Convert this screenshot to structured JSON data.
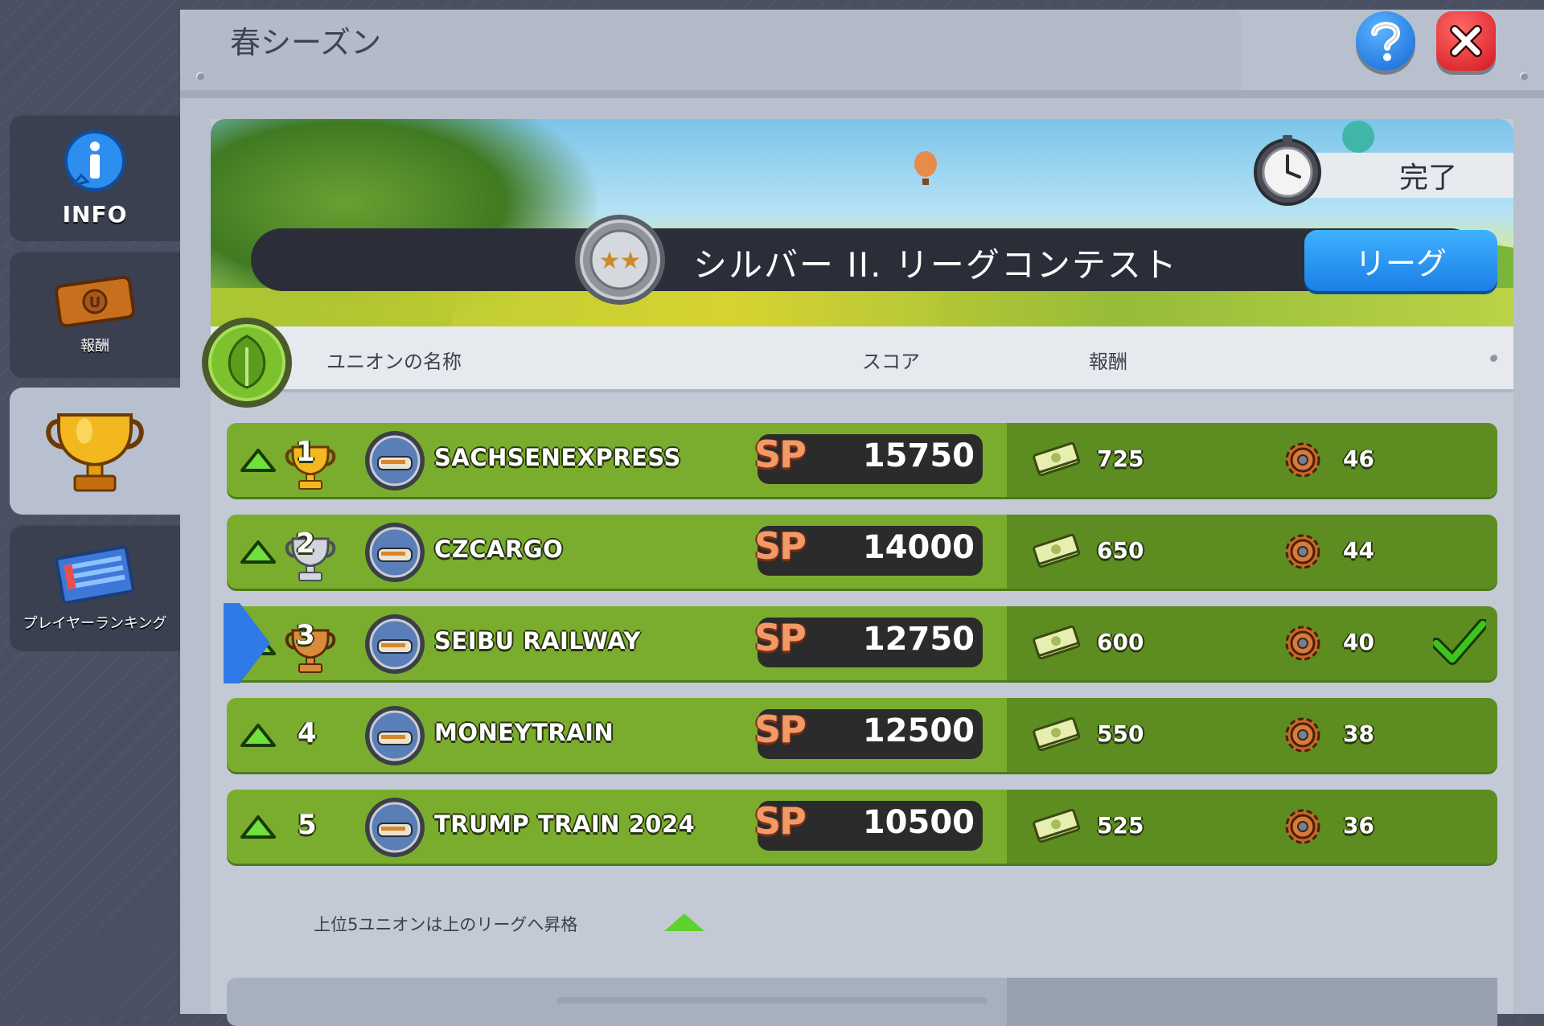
{
  "window": {
    "title": "春シーズン"
  },
  "sidebar": {
    "items": [
      {
        "label": "INFO",
        "icon": "info-icon"
      },
      {
        "label": "報酬",
        "icon": "ticket-icon"
      },
      {
        "label": "",
        "icon": "trophy-icon",
        "active": true
      },
      {
        "label": "プレイヤーランキング",
        "icon": "ranking-board-icon"
      }
    ]
  },
  "header_buttons": {
    "help_icon": "question-icon",
    "close_icon": "close-icon"
  },
  "banner": {
    "status": "完了",
    "contest_title": "シルバー II. リーグコンテスト",
    "league_button": "リーグ",
    "medal": "two-star-silver-medal"
  },
  "table": {
    "columns": [
      "ユニオンの名称",
      "スコア",
      "報酬"
    ],
    "score_prefix": "SP",
    "rows": [
      {
        "rank": "1",
        "rank_icon": "gold-trophy-icon",
        "name": "SACHSENEXPRESS",
        "score": "15750",
        "cash": "725",
        "gears": "46",
        "own": false
      },
      {
        "rank": "2",
        "rank_icon": "silver-trophy-icon",
        "name": "CZCARGO",
        "score": "14000",
        "cash": "650",
        "gears": "44",
        "own": false
      },
      {
        "rank": "3",
        "rank_icon": "bronze-trophy-icon",
        "name": "SEIBU RAILWAY",
        "score": "12750",
        "cash": "600",
        "gears": "40",
        "own": true
      },
      {
        "rank": "4",
        "rank_icon": "",
        "name": "MONEYTRAIN",
        "score": "12500",
        "cash": "550",
        "gears": "38",
        "own": false
      },
      {
        "rank": "5",
        "rank_icon": "",
        "name": "TRUMP TRAIN 2024",
        "score": "10500",
        "cash": "525",
        "gears": "36",
        "own": false
      }
    ]
  },
  "footer": {
    "promotion_note": "上位5ユニオンは上のリーグへ昇格"
  },
  "colors": {
    "row_green": "#7aad2d",
    "row_dark_green": "#5d8d21",
    "league_blue": "#1b7fe6",
    "close_red": "#d4181f",
    "sp_orange": "#f19a66"
  }
}
